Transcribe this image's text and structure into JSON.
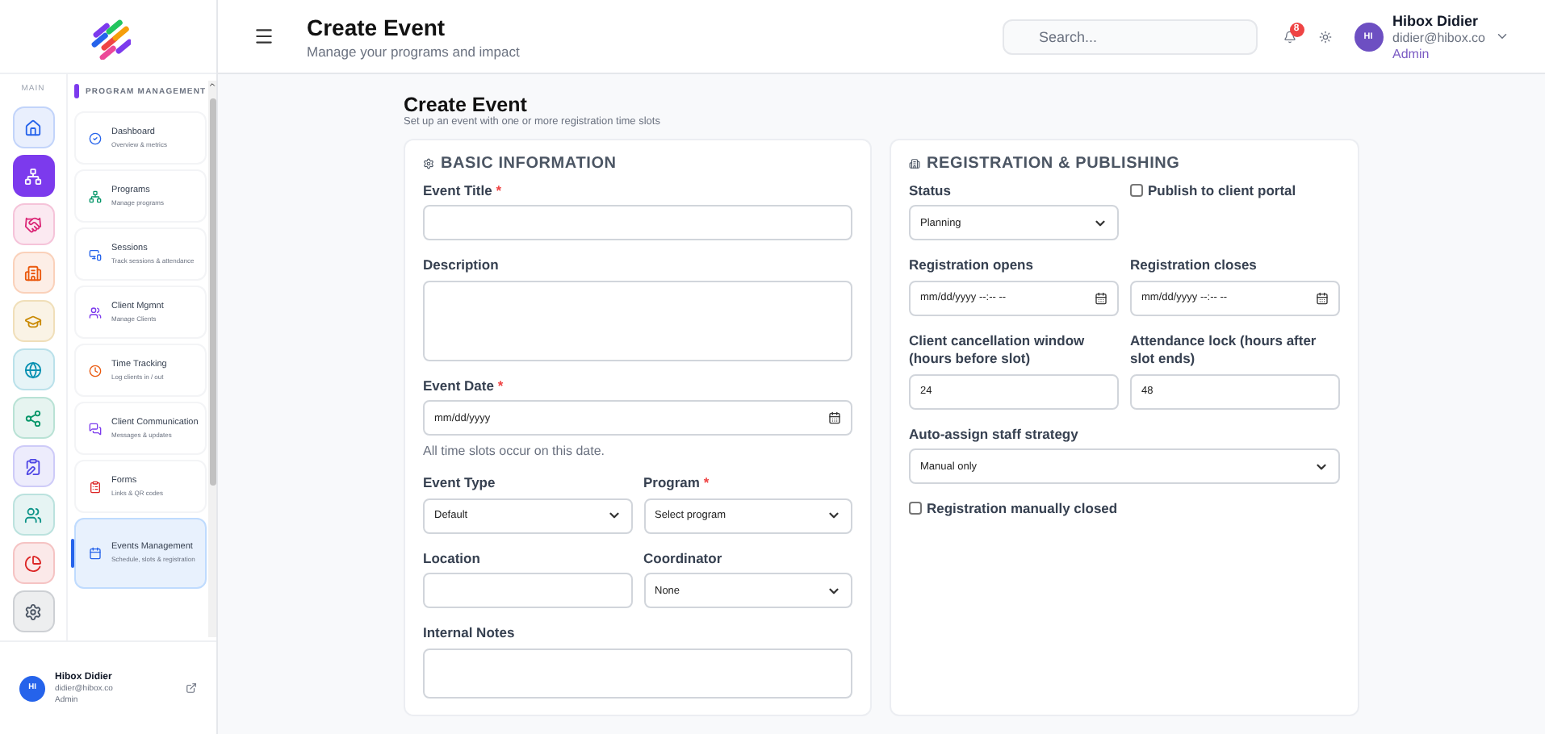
{
  "sidebar": {
    "rail_label": "MAIN",
    "section_title": "PROGRAM MANAGEMENT",
    "rail": [
      {
        "color": "#2563eb",
        "selected": false
      },
      {
        "color": "#7c3aed",
        "selected": true
      },
      {
        "color": "#db2777",
        "selected": false
      },
      {
        "color": "#ea580c",
        "selected": false
      },
      {
        "color": "#ca8a04",
        "selected": false
      },
      {
        "color": "#0891b2",
        "selected": false
      },
      {
        "color": "#059669",
        "selected": false
      },
      {
        "color": "#4f46e5",
        "selected": false
      },
      {
        "color": "#0d9488",
        "selected": false
      },
      {
        "color": "#dc2626",
        "selected": false
      },
      {
        "color": "#4b5563",
        "selected": false
      }
    ],
    "items": [
      {
        "label": "Dashboard",
        "sub": "Overview & metrics",
        "color": "#2563eb",
        "selected": false
      },
      {
        "label": "Programs",
        "sub": "Manage programs",
        "color": "#059669",
        "selected": false
      },
      {
        "label": "Sessions",
        "sub": "Track sessions & attendance",
        "color": "#2563eb",
        "selected": false
      },
      {
        "label": "Client Mgmnt",
        "sub": "Manage Clients",
        "color": "#7c3aed",
        "selected": false
      },
      {
        "label": "Time Tracking",
        "sub": "Log clients in / out",
        "color": "#ea580c",
        "selected": false
      },
      {
        "label": "Client Communication",
        "sub": "Messages & updates",
        "color": "#7c3aed",
        "selected": false
      },
      {
        "label": "Forms",
        "sub": "Links & QR codes",
        "color": "#dc2626",
        "selected": false
      },
      {
        "label": "Events Management",
        "sub": "Schedule, slots & registration",
        "color": "#2563eb",
        "selected": true
      }
    ],
    "user": {
      "initials": "HI",
      "name": "Hibox Didier",
      "email": "didier@hibox.co",
      "role": "Admin"
    }
  },
  "header": {
    "title": "Create Event",
    "subtitle": "Manage your programs and impact",
    "search_placeholder": "Search...",
    "notification_count": "8",
    "user": {
      "initials": "HI",
      "name": "Hibox Didier",
      "email": "didier@hibox.co",
      "role": "Admin"
    }
  },
  "page": {
    "title": "Create Event",
    "subtitle": "Set up an event with one or more registration time slots"
  },
  "cards": [
    {
      "title": "BASIC INFORMATION",
      "rows": [
        [
          {
            "kind": "text",
            "label": "Event Title",
            "required_mark": "*"
          }
        ],
        [
          {
            "kind": "textarea",
            "label": "Description"
          }
        ],
        [
          {
            "kind": "date",
            "label": "Event Date",
            "required_mark": "*",
            "value": "mm/dd/yyyy",
            "hint": "All time slots occur on this date."
          }
        ],
        [
          {
            "kind": "select",
            "label": "Event Type",
            "value": "Default"
          },
          {
            "kind": "select",
            "label": "Program",
            "required_mark": "*",
            "value": "Select program"
          }
        ],
        [
          {
            "kind": "text",
            "label": "Location"
          },
          {
            "kind": "select",
            "label": "Coordinator",
            "value": "None"
          }
        ],
        [
          {
            "kind": "textarea",
            "label": "Internal Notes"
          }
        ]
      ]
    },
    {
      "title": "REGISTRATION & PUBLISHING",
      "rows": [
        [
          {
            "kind": "select",
            "label": "Status",
            "value": "Planning"
          },
          {
            "kind": "checkbox",
            "label": "Publish to client portal",
            "checked": false
          }
        ],
        [
          {
            "kind": "date",
            "label": "Registration opens",
            "value": "mm/dd/yyyy --:-- --"
          },
          {
            "kind": "date",
            "label": "Registration closes",
            "value": "mm/dd/yyyy --:-- --"
          }
        ],
        [
          {
            "kind": "text",
            "label": "Client cancellation window (hours before slot)",
            "value": "24"
          },
          {
            "kind": "text",
            "label": "Attendance lock (hours after slot ends)",
            "value": "48"
          }
        ],
        [
          {
            "kind": "select",
            "label": "Auto-assign staff strategy",
            "value": "Manual only"
          }
        ],
        [
          {
            "kind": "checkbox",
            "label": "Registration manually closed",
            "checked": false
          }
        ]
      ]
    }
  ]
}
